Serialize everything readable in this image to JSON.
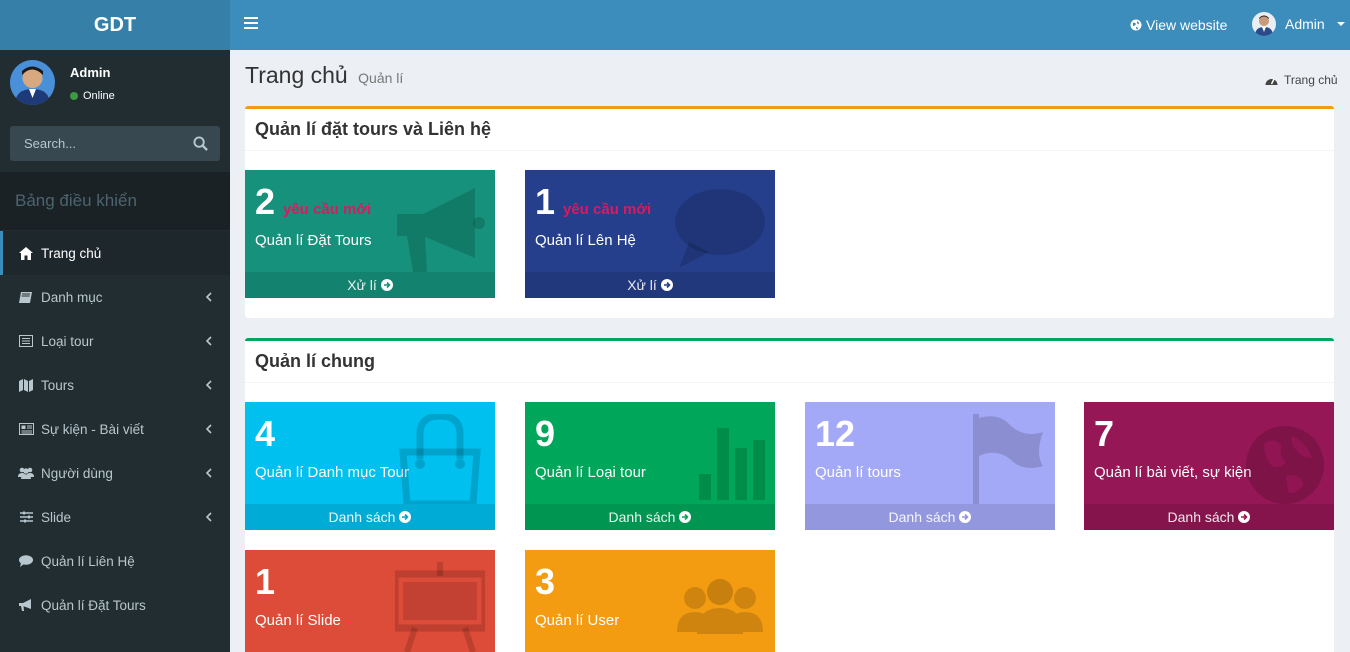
{
  "header": {
    "logo": "GDT",
    "view_website": "View website",
    "user": "Admin"
  },
  "sidebar": {
    "user_name": "Admin",
    "status": "Online",
    "search_placeholder": "Search...",
    "header": "Bảng điều khiển",
    "items": [
      {
        "label": "Trang chủ",
        "icon": "home-icon"
      },
      {
        "label": "Danh mục",
        "icon": "book-icon"
      },
      {
        "label": "Loại tour",
        "icon": "list-icon"
      },
      {
        "label": "Tours",
        "icon": "map-icon"
      },
      {
        "label": "Sự kiện - Bài viết",
        "icon": "newspaper-icon"
      },
      {
        "label": "Người dùng",
        "icon": "users-icon"
      },
      {
        "label": "Slide",
        "icon": "sliders-icon"
      },
      {
        "label": "Quản lí Liên Hệ",
        "icon": "comment-icon"
      },
      {
        "label": "Quản lí Đặt Tours",
        "icon": "bullhorn-icon"
      }
    ]
  },
  "page": {
    "title": "Trang chủ",
    "subtitle": "Quản lí",
    "breadcrumb": "Trang chủ"
  },
  "box1": {
    "title": "Quản lí đặt tours và Liên hệ",
    "tiles": [
      {
        "count": "2",
        "badge": "yêu cầu mới",
        "label": "Quản lí Đặt Tours",
        "action": "Xử lí",
        "color": "#16917b",
        "icon": "bullhorn-icon"
      },
      {
        "count": "1",
        "badge": "yêu cầu mới",
        "label": "Quản lí Lên Hệ",
        "action": "Xử lí",
        "color": "#253f8c",
        "icon": "comment-icon"
      }
    ]
  },
  "box2": {
    "title": "Quản lí chung",
    "tiles": [
      {
        "count": "4",
        "label": "Quản lí Danh mục Tour",
        "action": "Danh sách",
        "color": "#00c0ef",
        "icon": "shopping-bag-icon"
      },
      {
        "count": "9",
        "label": "Quản lí Loại tour",
        "action": "Danh sách",
        "color": "#00a65a",
        "icon": "bar-chart-icon"
      },
      {
        "count": "12",
        "label": "Quản lí tours",
        "action": "Danh sách",
        "color": "#a4a9f7",
        "icon": "flag-icon"
      },
      {
        "count": "7",
        "label": "Quản lí bài viết, sự kiện",
        "action": "Danh sách",
        "color": "#951755",
        "icon": "globe-icon"
      },
      {
        "count": "1",
        "label": "Quản lí Slide",
        "action": "",
        "color": "#dd4b39",
        "icon": "easel-icon"
      },
      {
        "count": "3",
        "label": "Quản lí User",
        "action": "",
        "color": "#f39c12",
        "icon": "group-icon"
      }
    ]
  }
}
